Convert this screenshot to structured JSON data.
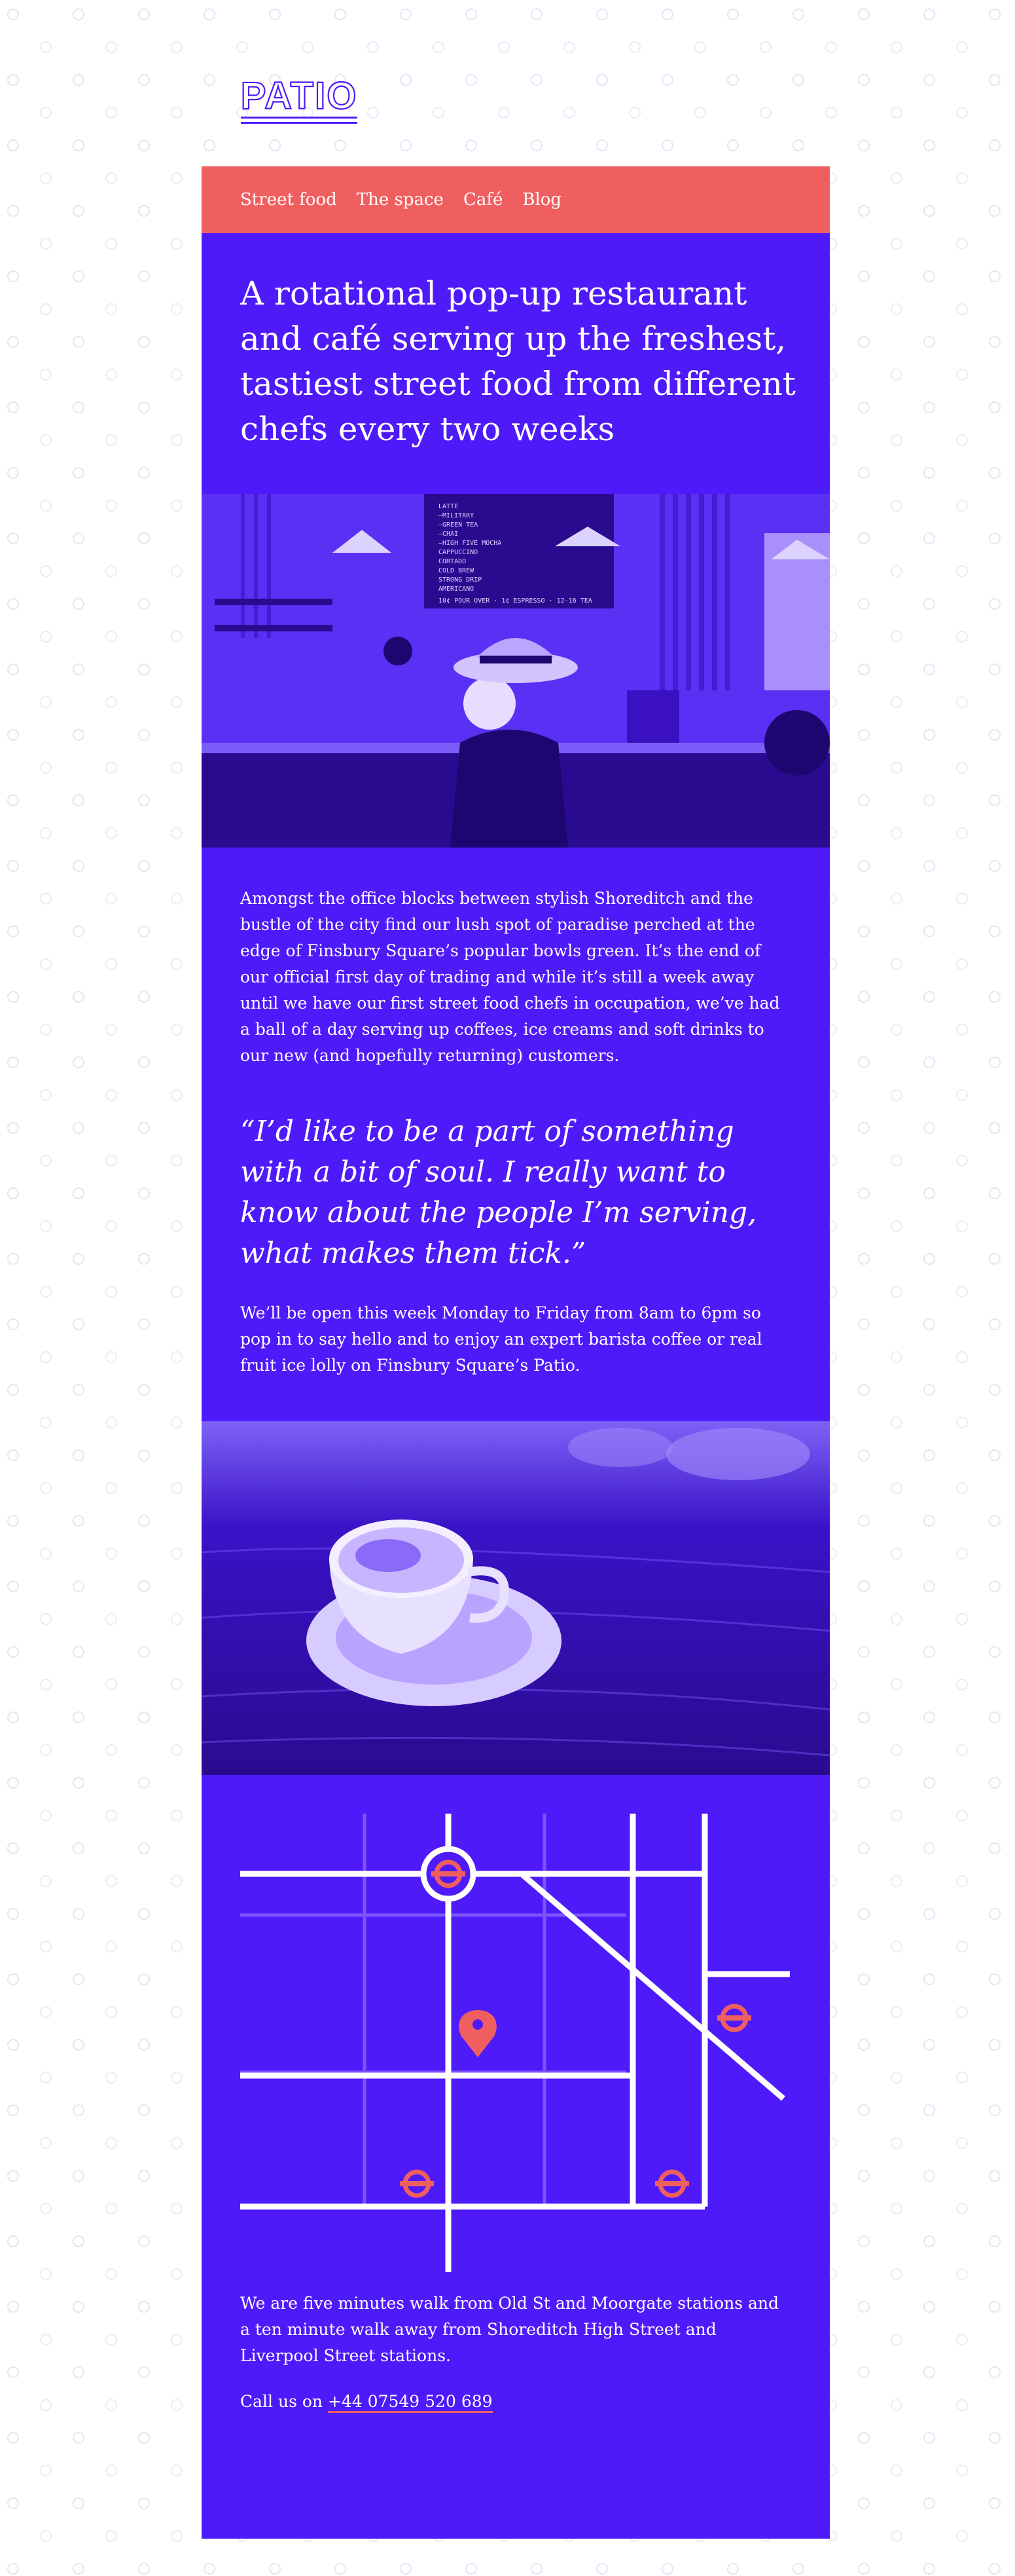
{
  "brand": {
    "logo_text": "PATIO"
  },
  "nav": {
    "items": [
      {
        "label": "Street food"
      },
      {
        "label": "The space"
      },
      {
        "label": "Café"
      },
      {
        "label": "Blog"
      }
    ]
  },
  "hero": {
    "headline": "A rotational pop-up restaurant and café serving up the freshest, tastiest street food from different chefs every two weeks"
  },
  "cafe_menu_board": {
    "items": [
      "LATTE",
      "—MILITARY",
      "—GREEN TEA",
      "—CHAI",
      "—HIGH FIVE MOCHA",
      "CAPPUCCINO",
      "CORTADO",
      "COLD BREW",
      "STRONG DRIP",
      "AMERICANO"
    ],
    "footer": "10¢ POUR OVER · 1¢ ESPRESSO · 12-16 TEA"
  },
  "content": {
    "intro": "Amongst the office blocks between stylish Shoreditch and the bustle of the city find our lush spot of paradise perched at the edge of Finsbury Square’s popular bowls green. It’s the end of our official first day of trading and while it’s still a week away until we have our first street food chefs in occupation, we’ve had a ball of a day serving up coffees, ice creams and soft drinks to our new (and hopefully returning) customers.",
    "quote": "“I’d like to be a part of something with a bit of soul. I really want to know about the people I’m serving, what makes them tick.”",
    "hours": "We’ll be open this week Monday to Friday from 8am to 6pm so pop in to say hello and to  enjoy an expert barista coffee or real fruit ice lolly on Finsbury Square’s Patio.",
    "stations": "We are five minutes walk from Old St and Moorgate stations and a ten minute walk away from Shoreditch High Street and Liverpool Street stations.",
    "call_prefix": "Call us on",
    "phone": "+44 07549 520 689"
  },
  "colors": {
    "brand_purple": "#4f1af9",
    "accent_coral": "#f05f60",
    "text_white": "#ffffff"
  }
}
